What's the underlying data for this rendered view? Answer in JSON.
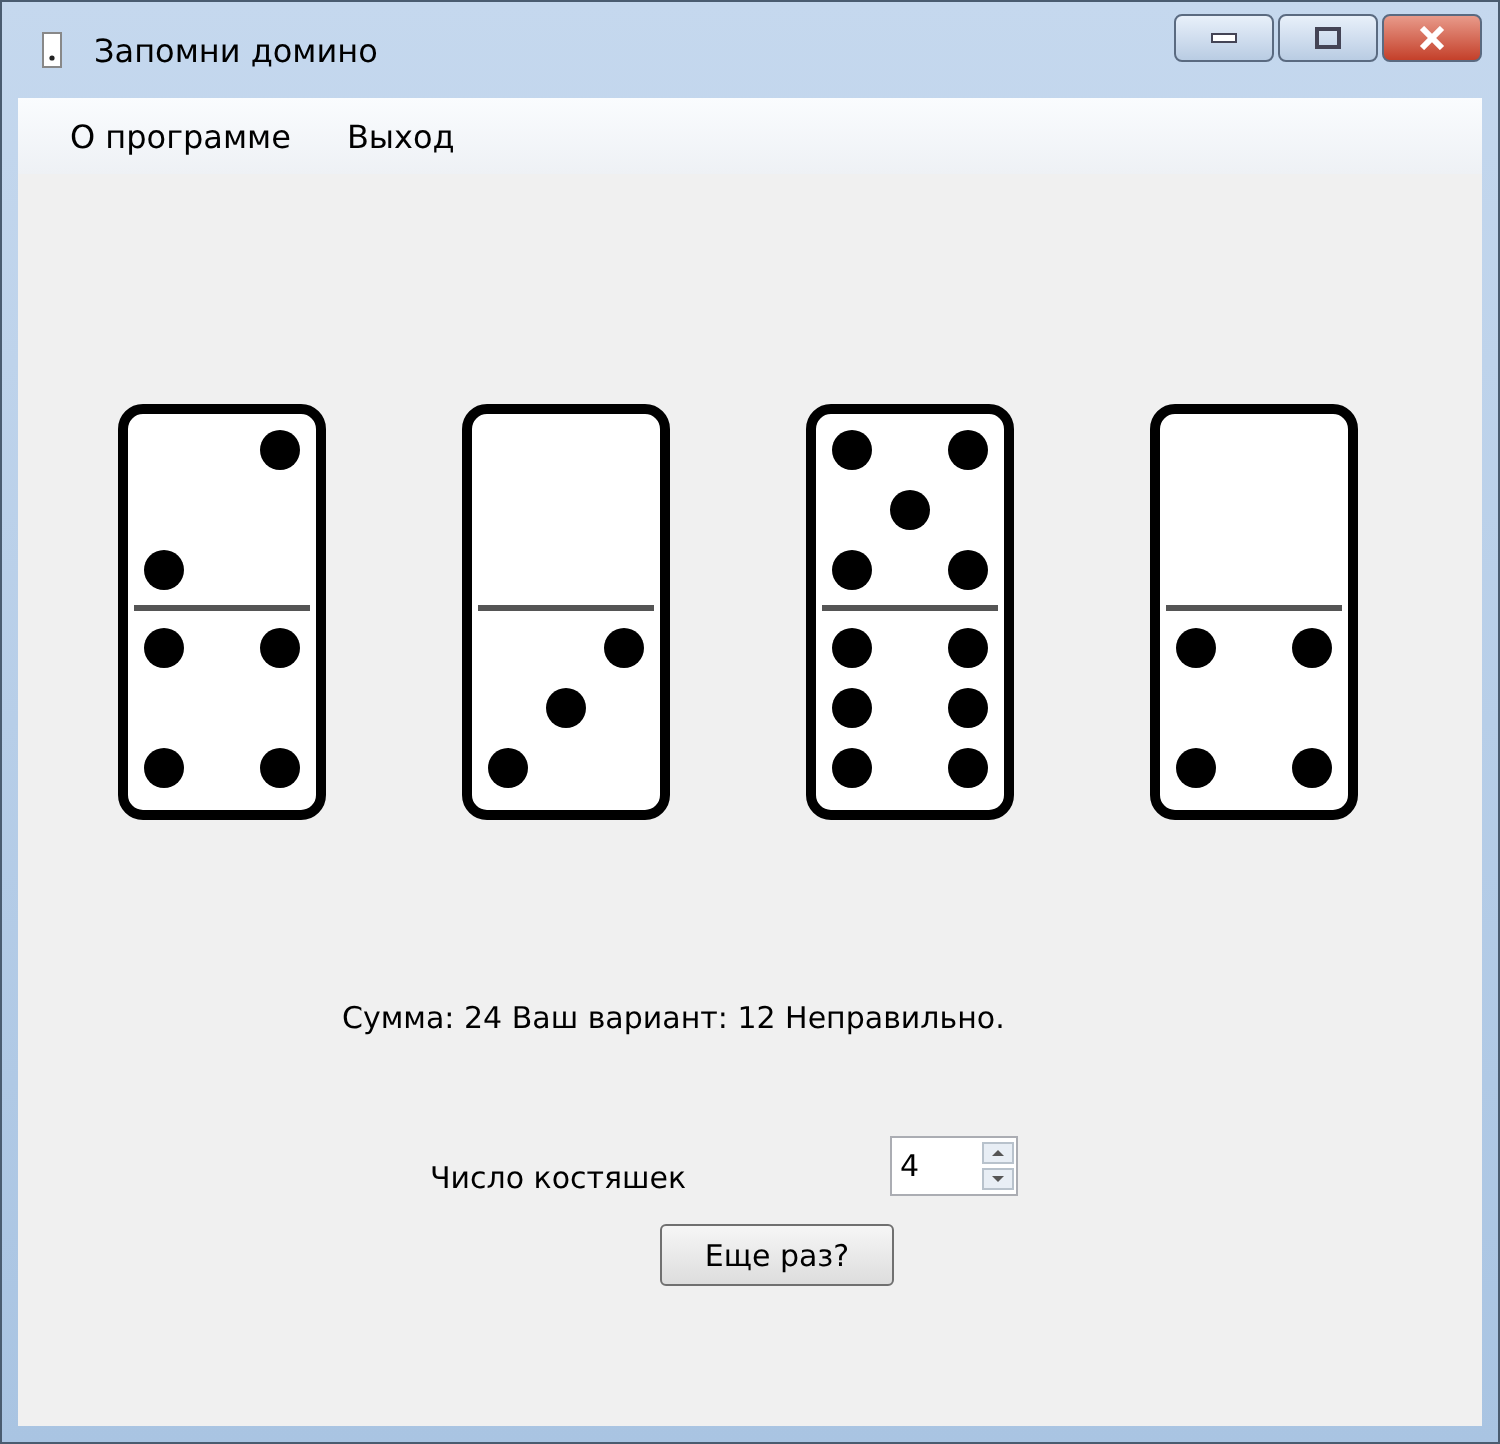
{
  "window": {
    "title": "Запомни домино"
  },
  "menu": [
    "О программе",
    "Выход"
  ],
  "dominoes": [
    {
      "top": {
        "kind": "two"
      },
      "bottom": {
        "kind": "four"
      }
    },
    {
      "top": {
        "kind": "blank"
      },
      "bottom": {
        "kind": "three"
      }
    },
    {
      "top": {
        "kind": "five"
      },
      "bottom": {
        "kind": "six"
      }
    },
    {
      "top": {
        "kind": "blank"
      },
      "bottom": {
        "kind": "four"
      }
    }
  ],
  "result": "Сумма: 24 Ваш вариант: 12 Неправильно.",
  "count": {
    "label": "Число костяшек",
    "value": "4"
  },
  "button": "Еще раз?"
}
